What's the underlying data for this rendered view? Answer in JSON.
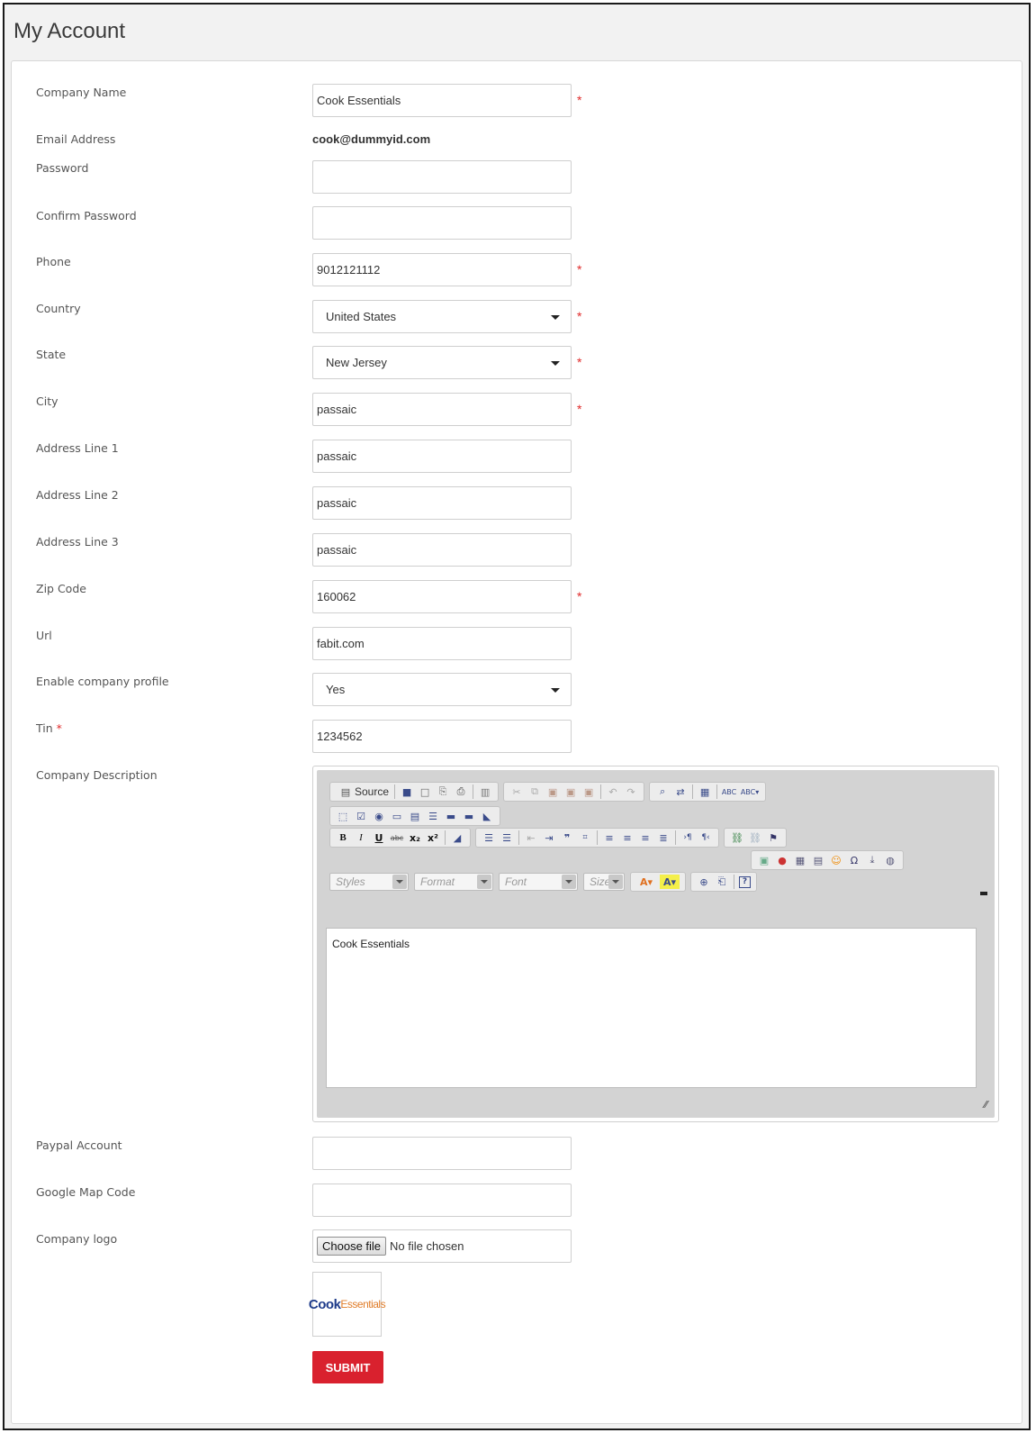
{
  "page": {
    "title": "My Account"
  },
  "form": {
    "company_name": {
      "label": "Company Name",
      "value": "Cook Essentials",
      "required": "*"
    },
    "email": {
      "label": "Email Address",
      "value": "cook@dummyid.com"
    },
    "password": {
      "label": "Password",
      "value": ""
    },
    "confirm_password": {
      "label": "Confirm Password",
      "value": ""
    },
    "phone": {
      "label": "Phone",
      "value": "9012121112",
      "required": "*"
    },
    "country": {
      "label": "Country",
      "value": "United States",
      "required": "*"
    },
    "state": {
      "label": "State",
      "value": "New Jersey",
      "required": "*"
    },
    "city": {
      "label": "City",
      "value": "passaic",
      "required": "*"
    },
    "address1": {
      "label": "Address Line 1",
      "value": "passaic"
    },
    "address2": {
      "label": "Address Line 2",
      "value": "passaic"
    },
    "address3": {
      "label": "Address Line 3",
      "value": "passaic"
    },
    "zip": {
      "label": "Zip Code",
      "value": "160062",
      "required": "*"
    },
    "url": {
      "label": "Url",
      "value": "fabit.com"
    },
    "enable_profile": {
      "label": "Enable company profile",
      "value": "Yes"
    },
    "tin": {
      "label": "Tin",
      "value": "1234562",
      "required": "*"
    },
    "description": {
      "label": "Company Description",
      "value": "Cook Essentials"
    },
    "paypal": {
      "label": "Paypal Account",
      "value": ""
    },
    "google_map": {
      "label": "Google Map Code",
      "value": ""
    },
    "logo": {
      "label": "Company logo",
      "choose_label": "Choose file",
      "status": "No file chosen",
      "logo_text_1": "Cook",
      "logo_text_2": "Essentials"
    },
    "submit_label": "SUBMIT"
  },
  "editor": {
    "source_label": "Source",
    "styles_label": "Styles",
    "format_label": "Format",
    "font_label": "Font",
    "size_label": "Size",
    "resize_glyph": "⁄⁄"
  },
  "colors": {
    "accent": "#d9212e",
    "required": "#e02b2b",
    "header_bg": "#f2f2f2"
  }
}
